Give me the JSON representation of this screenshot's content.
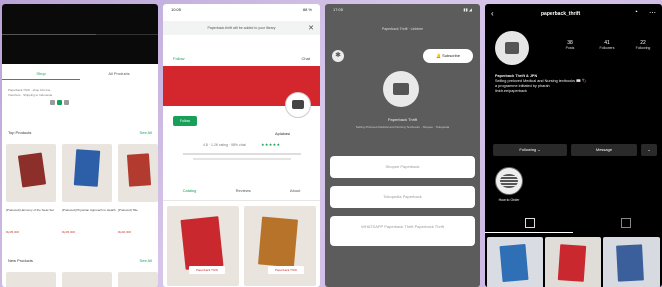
{
  "panel1": {
    "tabs": [
      "Shop",
      "All Products"
    ],
    "meta_lines": [
      "Paperback Thrift · shop info line",
      "Vouchers · Shipping to Indonesia"
    ],
    "sections": [
      {
        "title": "Top Products",
        "more": "See All"
      },
      {
        "title": "New Products",
        "more": "See All"
      }
    ],
    "products": [
      {
        "caption": "[Preloved] Harmony of the Seas Set",
        "price": "Rp35.000"
      },
      {
        "caption": "[Preloved] Physician Approach to Health",
        "price": "Rp45.000"
      },
      {
        "caption": "[Preloved] Title",
        "price": "Rp40.000"
      }
    ]
  },
  "panel2": {
    "status_left": "10:05",
    "status_right": "88 %",
    "notice": "Paperback.thrift  will be added to your  library",
    "title_left": "Follow",
    "title_right": "Chat",
    "follow_label": "Follow",
    "shop_name": "Aplakasi",
    "rating": "4.8 · 1.2K rating · 98% chat",
    "stars": "★★★★★",
    "tabs": [
      "Catalog",
      "Reviews",
      "About"
    ],
    "sticker": "Paperback Thrift"
  },
  "panel3": {
    "status_left": "17:05",
    "status_right": "▮▮ ◢",
    "header": "Paperback Thrift · Linktree",
    "subscribe": "Subscribe",
    "name": "Paperback Thrift",
    "description": "Selling Preloved Medical and Nursing Textbooks · Shopee · Tokopedia",
    "buttons": [
      "Shopee Paperback",
      "Tokopedia Paperback",
      "WHATSAPP Paperback Thrift Paperback Thrift"
    ]
  },
  "panel4": {
    "username": "paperback_thrift",
    "stats": [
      {
        "value": "38",
        "label": "Posts"
      },
      {
        "value": "41",
        "label": "Followers"
      },
      {
        "value": "22",
        "label": "Following"
      }
    ],
    "bio": [
      "Paperback Thrift & JPN",
      "Selling preloved Medical and Nursing textbooks 📖 🏷",
      "a programme initiated by pharah",
      "linktr.ee/paperback"
    ],
    "following_label": "Following ⌄",
    "message_label": "Message",
    "highlight_label": "How to Order"
  }
}
